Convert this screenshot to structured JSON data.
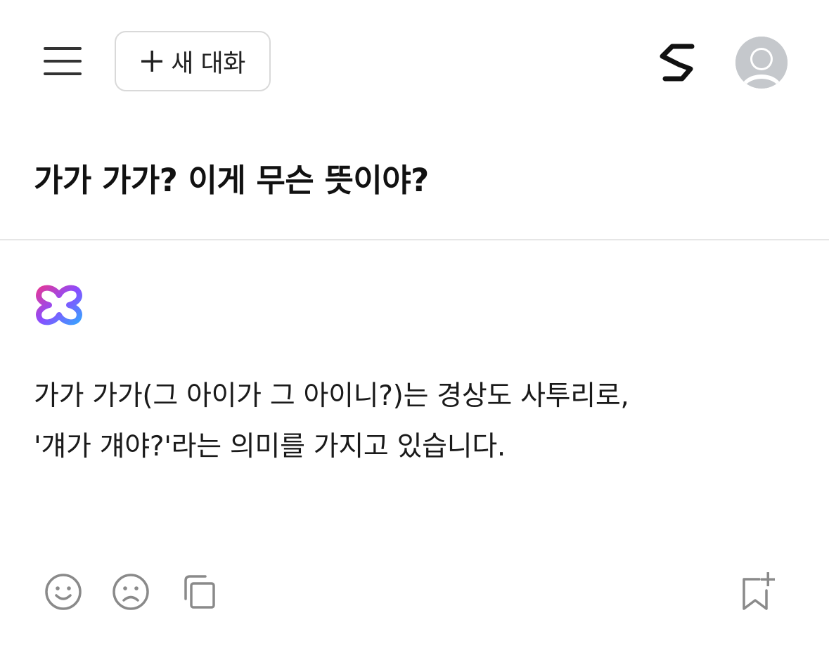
{
  "header": {
    "menu_icon": "hamburger-menu-icon",
    "new_chat_label": "새 대화",
    "brand_icon": "s-logo-icon",
    "avatar_icon": "user-avatar-icon"
  },
  "conversation": {
    "question": "가가 가가? 이게 무슨 뜻이야?",
    "ai_logo_icon": "ai-assistant-logo-icon",
    "answer_lines": [
      "가가 가가(그 아이가 그 아이니?)는 경상도 사투리로,",
      "'걔가 걔야?'라는 의미를 가지고 있습니다."
    ]
  },
  "actions": {
    "like_icon": "smile-face-icon",
    "dislike_icon": "frown-face-icon",
    "copy_icon": "copy-icon",
    "bookmark_icon": "bookmark-add-icon"
  },
  "colors": {
    "logo_gradient": [
      "#e0389c",
      "#8a4dff",
      "#3aa0ff"
    ],
    "icon_gray": "#8a8a8a",
    "avatar_bg": "#c5c8cc"
  }
}
